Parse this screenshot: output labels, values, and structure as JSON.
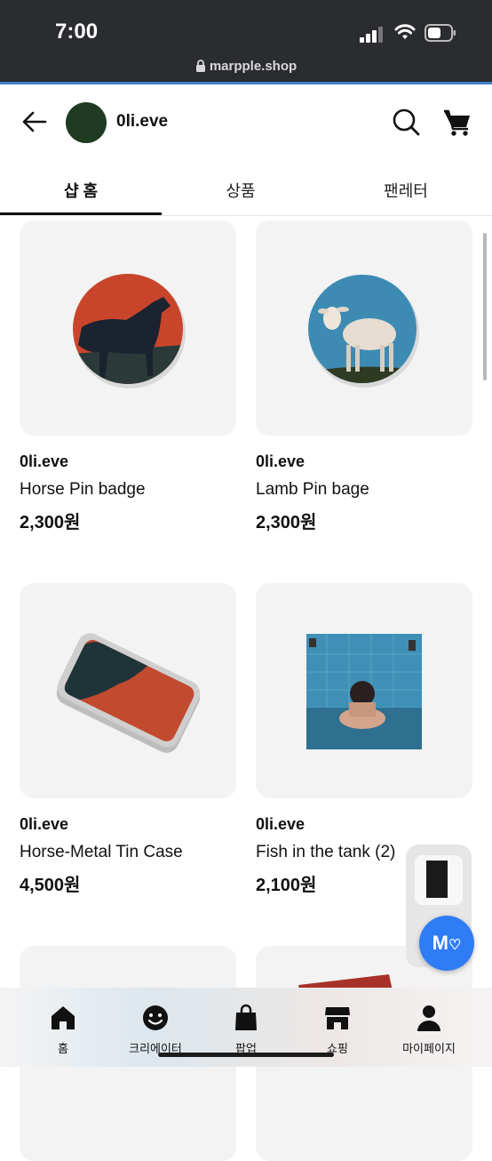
{
  "status_bar": {
    "time": "7:00",
    "url": "marpple.shop"
  },
  "header": {
    "shop_name": "0li.eve"
  },
  "tabs": [
    {
      "label": "샵 홈",
      "active": true
    },
    {
      "label": "상품",
      "active": false
    },
    {
      "label": "팬레터",
      "active": false
    }
  ],
  "products": [
    {
      "brand": "0li.eve",
      "name": "Horse Pin badge",
      "price": "2,300원"
    },
    {
      "brand": "0li.eve",
      "name": "Lamb Pin bage",
      "price": "2,300원"
    },
    {
      "brand": "0li.eve",
      "name": "Horse-Metal Tin Case",
      "price": "4,500원"
    },
    {
      "brand": "0li.eve",
      "name": "Fish in the tank (2)",
      "price": "2,100원"
    }
  ],
  "floating": {
    "logo": "M"
  },
  "bottom_nav": [
    {
      "label": "홈",
      "icon": "home-icon"
    },
    {
      "label": "크리에이터",
      "icon": "smile-icon"
    },
    {
      "label": "팝업",
      "icon": "bag-icon"
    },
    {
      "label": "쇼핑",
      "icon": "store-icon"
    },
    {
      "label": "마이페이지",
      "icon": "person-icon"
    }
  ],
  "colors": {
    "accent_blue": "#2f7df6",
    "avatar_green": "#1f3b22",
    "status_bar": "#2a2c30"
  }
}
